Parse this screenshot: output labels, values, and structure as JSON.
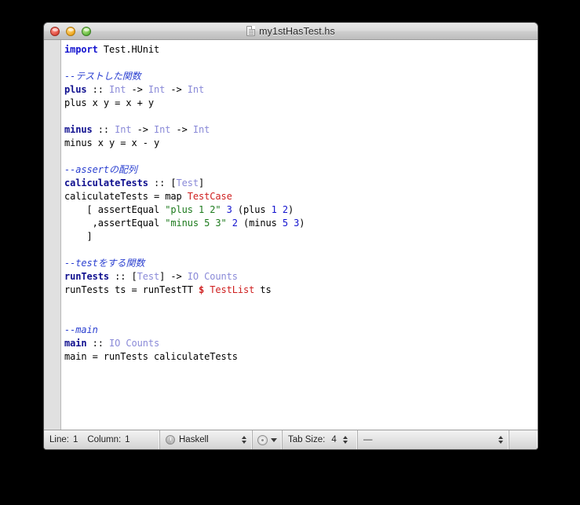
{
  "window": {
    "title": "my1stHasTest.hs",
    "doc_icon": "document-icon",
    "controls": {
      "close": "close-button",
      "minimize": "minimize-button",
      "zoom": "zoom-button"
    }
  },
  "editor": {
    "language": "Haskell",
    "code_lines": [
      {
        "indent": 0,
        "tokens": [
          {
            "t": "import",
            "c": "kw"
          },
          {
            "t": " Test.HUnit",
            "c": "op"
          }
        ]
      },
      {
        "indent": 0,
        "tokens": []
      },
      {
        "indent": 0,
        "tokens": [
          {
            "t": "--テストした関数",
            "c": "cmt"
          }
        ]
      },
      {
        "indent": 0,
        "tokens": [
          {
            "t": "plus",
            "c": "fn"
          },
          {
            "t": " :: ",
            "c": "op"
          },
          {
            "t": "Int",
            "c": "typ"
          },
          {
            "t": " -> ",
            "c": "op"
          },
          {
            "t": "Int",
            "c": "typ"
          },
          {
            "t": " -> ",
            "c": "op"
          },
          {
            "t": "Int",
            "c": "typ"
          }
        ]
      },
      {
        "indent": 0,
        "tokens": [
          {
            "t": "plus x y = x + y",
            "c": "op"
          }
        ]
      },
      {
        "indent": 0,
        "tokens": []
      },
      {
        "indent": 0,
        "tokens": [
          {
            "t": "minus",
            "c": "fn"
          },
          {
            "t": " :: ",
            "c": "op"
          },
          {
            "t": "Int",
            "c": "typ"
          },
          {
            "t": " -> ",
            "c": "op"
          },
          {
            "t": "Int",
            "c": "typ"
          },
          {
            "t": " -> ",
            "c": "op"
          },
          {
            "t": "Int",
            "c": "typ"
          }
        ]
      },
      {
        "indent": 0,
        "tokens": [
          {
            "t": "minus x y = x - y",
            "c": "op"
          }
        ]
      },
      {
        "indent": 0,
        "tokens": []
      },
      {
        "indent": 0,
        "tokens": [
          {
            "t": "--assertの配列",
            "c": "cmt"
          }
        ]
      },
      {
        "indent": 0,
        "tokens": [
          {
            "t": "caliculateTests",
            "c": "fn"
          },
          {
            "t": " :: [",
            "c": "op"
          },
          {
            "t": "Test",
            "c": "typ"
          },
          {
            "t": "]",
            "c": "op"
          }
        ]
      },
      {
        "indent": 0,
        "tokens": [
          {
            "t": "caliculateTests = map ",
            "c": "op"
          },
          {
            "t": "TestCase",
            "c": "con"
          }
        ]
      },
      {
        "indent": 4,
        "tokens": [
          {
            "t": "[ assertEqual ",
            "c": "op"
          },
          {
            "t": "\"plus 1 2\"",
            "c": "str"
          },
          {
            "t": " ",
            "c": "op"
          },
          {
            "t": "3",
            "c": "num"
          },
          {
            "t": " (plus ",
            "c": "op"
          },
          {
            "t": "1",
            "c": "num"
          },
          {
            "t": " ",
            "c": "op"
          },
          {
            "t": "2",
            "c": "num"
          },
          {
            "t": ")",
            "c": "op"
          }
        ]
      },
      {
        "indent": 5,
        "tokens": [
          {
            "t": ",assertEqual ",
            "c": "op"
          },
          {
            "t": "\"minus 5 3\"",
            "c": "str"
          },
          {
            "t": " ",
            "c": "op"
          },
          {
            "t": "2",
            "c": "num"
          },
          {
            "t": " (minus ",
            "c": "op"
          },
          {
            "t": "5",
            "c": "num"
          },
          {
            "t": " ",
            "c": "op"
          },
          {
            "t": "3",
            "c": "num"
          },
          {
            "t": ")",
            "c": "op"
          }
        ]
      },
      {
        "indent": 4,
        "tokens": [
          {
            "t": "]",
            "c": "op"
          }
        ]
      },
      {
        "indent": 0,
        "tokens": []
      },
      {
        "indent": 0,
        "tokens": [
          {
            "t": "--testをする関数",
            "c": "cmt"
          }
        ]
      },
      {
        "indent": 0,
        "tokens": [
          {
            "t": "runTests",
            "c": "fn"
          },
          {
            "t": " :: [",
            "c": "op"
          },
          {
            "t": "Test",
            "c": "typ"
          },
          {
            "t": "] -> ",
            "c": "op"
          },
          {
            "t": "IO",
            "c": "typ"
          },
          {
            "t": " ",
            "c": "op"
          },
          {
            "t": "Counts",
            "c": "typ"
          }
        ]
      },
      {
        "indent": 0,
        "tokens": [
          {
            "t": "runTests ts = runTestTT ",
            "c": "op"
          },
          {
            "t": "$",
            "c": "dollar"
          },
          {
            "t": " ",
            "c": "op"
          },
          {
            "t": "TestList",
            "c": "con"
          },
          {
            "t": " ts",
            "c": "op"
          }
        ]
      },
      {
        "indent": 0,
        "tokens": []
      },
      {
        "indent": 0,
        "tokens": []
      },
      {
        "indent": 0,
        "tokens": [
          {
            "t": "--main",
            "c": "cmt"
          }
        ]
      },
      {
        "indent": 0,
        "tokens": [
          {
            "t": "main",
            "c": "fn"
          },
          {
            "t": " :: ",
            "c": "op"
          },
          {
            "t": "IO",
            "c": "typ"
          },
          {
            "t": " ",
            "c": "op"
          },
          {
            "t": "Counts",
            "c": "typ"
          }
        ]
      },
      {
        "indent": 0,
        "tokens": [
          {
            "t": "main = runTests caliculateTests",
            "c": "op"
          }
        ]
      }
    ]
  },
  "statusbar": {
    "line_label": "Line:",
    "line_value": "1",
    "column_label": "Column:",
    "column_value": "1",
    "language_value": "Haskell",
    "tabsize_label": "Tab Size:",
    "tabsize_value": "4",
    "encoding_value": "—"
  },
  "colors": {
    "keyword": "#1414cf",
    "function": "#10108f",
    "type": "#8a8ad8",
    "constructor": "#cf2020",
    "string": "#1d7a1d",
    "number": "#1414cf",
    "comment": "#2a3fd0",
    "background": "#ffffff",
    "gutter": "#e0e0e0",
    "desktop": "#000000"
  }
}
